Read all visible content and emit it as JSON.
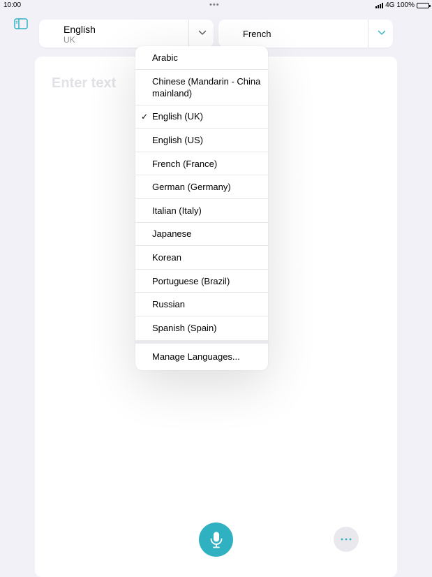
{
  "status_bar": {
    "time": "10:00",
    "dots": "•••",
    "network": "4G",
    "battery": "100%"
  },
  "sidebar_toggle": {
    "icon": "sidebar-icon"
  },
  "source_language": {
    "name": "English",
    "region": "UK"
  },
  "target_language": {
    "name": "French"
  },
  "text_input": {
    "placeholder": "Enter text"
  },
  "language_menu": {
    "items": [
      {
        "label": "Arabic"
      },
      {
        "label": "Chinese (Mandarin - China mainland)"
      },
      {
        "label": "English (UK)",
        "checked": true
      },
      {
        "label": "English (US)"
      },
      {
        "label": "French (France)"
      },
      {
        "label": "German (Germany)"
      },
      {
        "label": "Italian (Italy)"
      },
      {
        "label": "Japanese"
      },
      {
        "label": "Korean"
      },
      {
        "label": "Portuguese (Brazil)"
      },
      {
        "label": "Russian"
      },
      {
        "label": "Spanish (Spain)"
      }
    ],
    "check_mark": "✓",
    "manage_label": "Manage Languages..."
  },
  "bottom": {
    "mic_icon": "microphone-icon",
    "more_icon": "ellipsis-icon",
    "more_glyph": "•••"
  },
  "colors": {
    "accent": "#2fb1c2",
    "background": "#f2f1f7",
    "card": "#ffffff",
    "placeholder": "#e1e1e6"
  }
}
